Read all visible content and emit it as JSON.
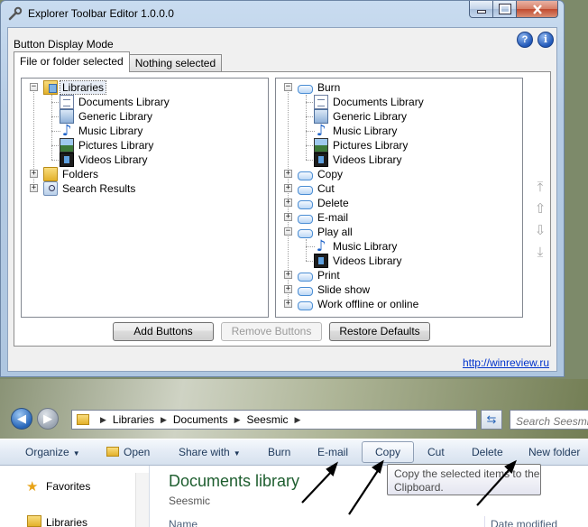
{
  "editor": {
    "title": "Explorer Toolbar Editor 1.0.0.0",
    "mode_label": "Button Display Mode",
    "tabs": [
      "File or folder selected",
      "Nothing selected"
    ],
    "left_tree": {
      "libraries": "Libraries",
      "library_children": [
        "Documents Library",
        "Generic Library",
        "Music Library",
        "Pictures Library",
        "Videos Library"
      ],
      "folders": "Folders",
      "search_results": "Search Results"
    },
    "right_tree": {
      "burn": "Burn",
      "burn_children": [
        "Documents Library",
        "Generic Library",
        "Music Library",
        "Pictures Library",
        "Videos Library"
      ],
      "copy": "Copy",
      "cut": "Cut",
      "delete": "Delete",
      "email": "E-mail",
      "play_all": "Play all",
      "play_all_children": [
        "Music Library",
        "Videos Library"
      ],
      "print": "Print",
      "slide_show": "Slide show",
      "work_offline": "Work offline or online"
    },
    "buttons": {
      "add": "Add Buttons",
      "remove": "Remove Buttons",
      "restore": "Restore Defaults"
    },
    "link": "http://winreview.ru"
  },
  "explorer": {
    "breadcrumb": [
      "Libraries",
      "Documents",
      "Seesmic"
    ],
    "search_placeholder": "Search Seesmic",
    "commands": {
      "organize": "Organize",
      "open": "Open",
      "share_with": "Share with",
      "burn": "Burn",
      "email": "E-mail",
      "copy": "Copy",
      "cut": "Cut",
      "delete": "Delete",
      "new_folder": "New folder"
    },
    "nav": {
      "favorites": "Favorites",
      "libraries": "Libraries"
    },
    "library_title": "Documents library",
    "library_subtitle": "Seesmic",
    "columns": {
      "name": "Name",
      "date_modified": "Date modified"
    },
    "tooltip": "Copy the selected items to the Clipboard."
  }
}
